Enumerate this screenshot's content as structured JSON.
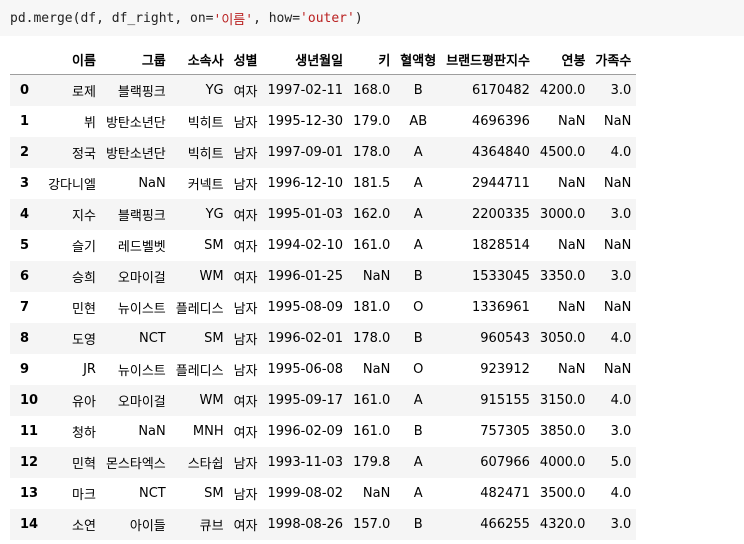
{
  "code": {
    "prefix": "pd.merge(df, df_right, on=",
    "on_value": "'이름'",
    "mid": ", how=",
    "how_value": "'outer'",
    "suffix": ")"
  },
  "table": {
    "columns": [
      "",
      "이름",
      "그룹",
      "소속사",
      "성별",
      "생년월일",
      "키",
      "혈액형",
      "브랜드평판지수",
      "연봉",
      "가족수"
    ],
    "rows": [
      [
        "0",
        "로제",
        "블랙핑크",
        "YG",
        "여자",
        "1997-02-11",
        "168.0",
        "B",
        "6170482",
        "4200.0",
        "3.0"
      ],
      [
        "1",
        "뷔",
        "방탄소년단",
        "빅히트",
        "남자",
        "1995-12-30",
        "179.0",
        "AB",
        "4696396",
        "NaN",
        "NaN"
      ],
      [
        "2",
        "정국",
        "방탄소년단",
        "빅히트",
        "남자",
        "1997-09-01",
        "178.0",
        "A",
        "4364840",
        "4500.0",
        "4.0"
      ],
      [
        "3",
        "강다니엘",
        "NaN",
        "커넥트",
        "남자",
        "1996-12-10",
        "181.5",
        "A",
        "2944711",
        "NaN",
        "NaN"
      ],
      [
        "4",
        "지수",
        "블랙핑크",
        "YG",
        "여자",
        "1995-01-03",
        "162.0",
        "A",
        "2200335",
        "3000.0",
        "3.0"
      ],
      [
        "5",
        "슬기",
        "레드벨벳",
        "SM",
        "여자",
        "1994-02-10",
        "161.0",
        "A",
        "1828514",
        "NaN",
        "NaN"
      ],
      [
        "6",
        "승희",
        "오마이걸",
        "WM",
        "여자",
        "1996-01-25",
        "NaN",
        "B",
        "1533045",
        "3350.0",
        "3.0"
      ],
      [
        "7",
        "민현",
        "뉴이스트",
        "플레디스",
        "남자",
        "1995-08-09",
        "181.0",
        "O",
        "1336961",
        "NaN",
        "NaN"
      ],
      [
        "8",
        "도영",
        "NCT",
        "SM",
        "남자",
        "1996-02-01",
        "178.0",
        "B",
        "960543",
        "3050.0",
        "4.0"
      ],
      [
        "9",
        "JR",
        "뉴이스트",
        "플레디스",
        "남자",
        "1995-06-08",
        "NaN",
        "O",
        "923912",
        "NaN",
        "NaN"
      ],
      [
        "10",
        "유아",
        "오마이걸",
        "WM",
        "여자",
        "1995-09-17",
        "161.0",
        "A",
        "915155",
        "3150.0",
        "4.0"
      ],
      [
        "11",
        "청하",
        "NaN",
        "MNH",
        "여자",
        "1996-02-09",
        "161.0",
        "B",
        "757305",
        "3850.0",
        "3.0"
      ],
      [
        "12",
        "민혁",
        "몬스타엑스",
        "스타쉽",
        "남자",
        "1993-11-03",
        "179.8",
        "A",
        "607966",
        "4000.0",
        "5.0"
      ],
      [
        "13",
        "마크",
        "NCT",
        "SM",
        "남자",
        "1999-08-02",
        "NaN",
        "A",
        "482471",
        "3500.0",
        "4.0"
      ],
      [
        "14",
        "소연",
        "아이들",
        "큐브",
        "여자",
        "1998-08-26",
        "157.0",
        "B",
        "466255",
        "4320.0",
        "3.0"
      ]
    ]
  }
}
